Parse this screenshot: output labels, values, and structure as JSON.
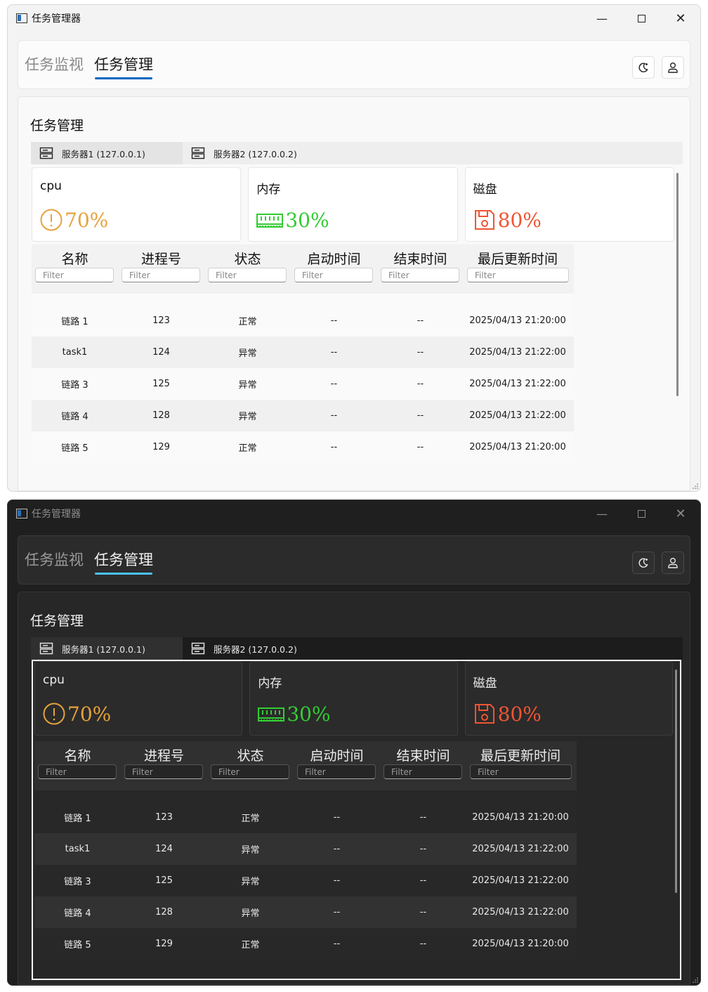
{
  "window": {
    "title": "任务管理器",
    "controls": {
      "minimize": "—",
      "close": "✕"
    }
  },
  "nav": {
    "tabs": [
      {
        "label": "任务监视",
        "active": false
      },
      {
        "label": "任务管理",
        "active": true
      }
    ],
    "actions": [
      {
        "name": "theme-toggle",
        "icon": "moon-icon"
      },
      {
        "name": "user",
        "icon": "user-icon"
      }
    ]
  },
  "panel": {
    "title": "任务管理",
    "server_tabs": [
      {
        "label": "服务器1 (127.0.0.1)",
        "icon": "server-icon",
        "active": true
      },
      {
        "label": "服务器2 (127.0.0.2)",
        "icon": "server-icon",
        "active": false
      }
    ],
    "stats": [
      {
        "label": "cpu",
        "value": "70%",
        "icon": "warning-circle-icon",
        "color": "#e6a23c"
      },
      {
        "label": "内存",
        "value": "30%",
        "icon": "memory-icon",
        "color": "#33cc33"
      },
      {
        "label": "磁盘",
        "value": "80%",
        "icon": "floppy-disk-icon",
        "color": "#ef5533"
      }
    ]
  },
  "table": {
    "columns": [
      "名称",
      "进程号",
      "状态",
      "启动时间",
      "结束时间",
      "最后更新时间"
    ],
    "filter_placeholder": "Filter",
    "rows": [
      [
        "链路 1",
        "123",
        "正常",
        "--",
        "--",
        "2025/04/13 21:20:00"
      ],
      [
        "task1",
        "124",
        "异常",
        "--",
        "--",
        "2025/04/13 21:22:00"
      ],
      [
        "链路 3",
        "125",
        "异常",
        "--",
        "--",
        "2025/04/13 21:22:00"
      ],
      [
        "链路 4",
        "128",
        "异常",
        "--",
        "--",
        "2025/04/13 21:22:00"
      ],
      [
        "链路 5",
        "129",
        "正常",
        "--",
        "--",
        "2025/04/13 21:20:00"
      ]
    ]
  },
  "themes": {
    "light": {
      "accent": "#0067c0",
      "background": "#f3f3f3"
    },
    "dark": {
      "accent": "#4cc2ff",
      "background": "#1f1f1f"
    }
  }
}
